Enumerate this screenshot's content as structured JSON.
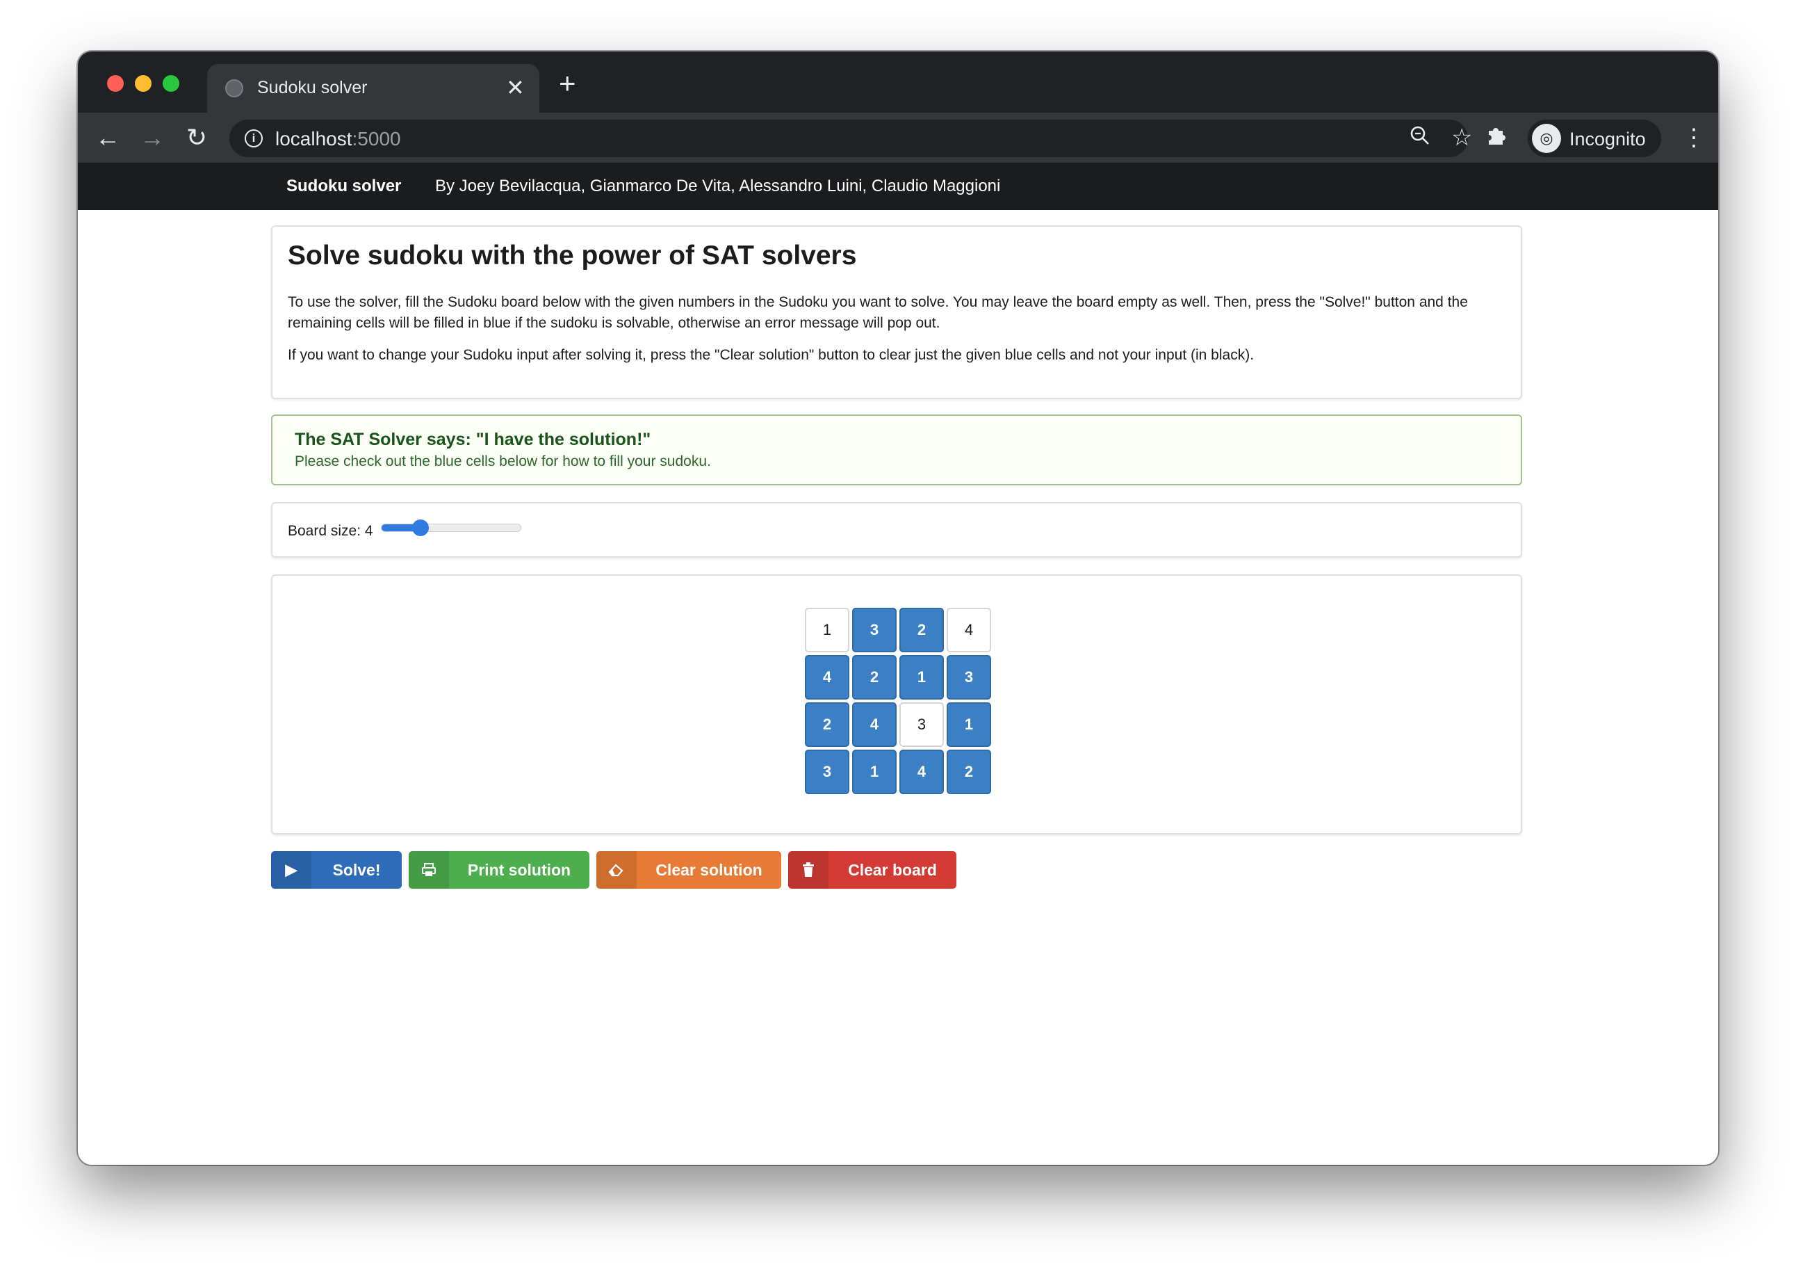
{
  "browser": {
    "tab_title": "Sudoku solver",
    "url_host": "localhost",
    "url_port": ":5000",
    "profile_label": "Incognito"
  },
  "nav": {
    "brand": "Sudoku solver",
    "authors": "By Joey Bevilacqua, Gianmarco De Vita, Alessandro Luini, Claudio Maggioni"
  },
  "intro": {
    "title": "Solve sudoku with the power of SAT solvers",
    "paragraph1": "To use the solver, fill the Sudoku board below with the given numbers in the Sudoku you want to solve. You may leave the board empty as well. Then, press the \"Solve!\" button and the remaining cells will be filled in blue if the sudoku is solvable, otherwise an error message will pop out.",
    "paragraph2": "If you want to change your Sudoku input after solving it, press the \"Clear solution\" button to clear just the given blue cells and not your input (in black)."
  },
  "message": {
    "header": "The SAT Solver says: \"I have the solution!\"",
    "body": "Please check out the blue cells below for how to fill your sudoku."
  },
  "board_size": {
    "label": "Board size: 4",
    "slider_fraction": 0.28
  },
  "board": {
    "cells": [
      [
        "1",
        "3",
        "2",
        "4"
      ],
      [
        "4",
        "2",
        "1",
        "3"
      ],
      [
        "2",
        "4",
        "3",
        "1"
      ],
      [
        "3",
        "1",
        "4",
        "2"
      ]
    ],
    "solved_mask": [
      [
        false,
        true,
        true,
        false
      ],
      [
        true,
        true,
        true,
        true
      ],
      [
        true,
        true,
        false,
        true
      ],
      [
        true,
        true,
        true,
        true
      ]
    ]
  },
  "buttons": {
    "solve": "Solve!",
    "print": "Print solution",
    "clear_solution": "Clear solution",
    "clear_board": "Clear board"
  },
  "colors": {
    "solved_cell": "#3b7fc4",
    "solve_button": "#2e6bb8",
    "print_button": "#4cae4c",
    "clear_solution_button": "#e77a35",
    "clear_board_button": "#d43a34",
    "success_header": "#1a531b"
  },
  "icons": {
    "solve": "play-icon",
    "print": "printer-icon",
    "clear_solution": "eraser-icon",
    "clear_board": "trash-icon"
  }
}
